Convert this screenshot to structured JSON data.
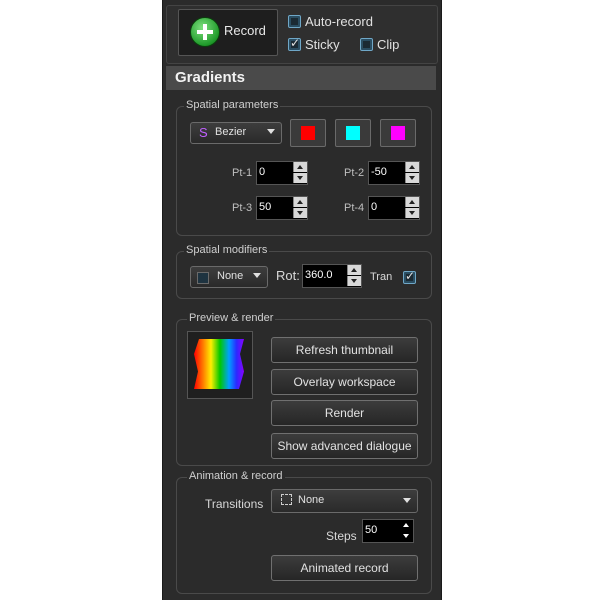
{
  "toolbar": {
    "record_label": "Record",
    "auto_record_label": "Auto-record",
    "sticky_label": "Sticky",
    "clip_label": "Clip",
    "auto_record_checked": false,
    "sticky_checked": true,
    "clip_checked": false
  },
  "header": {
    "title": "Gradients"
  },
  "spatial_parameters": {
    "title": "Spatial parameters",
    "type_label": "Bezier",
    "colors": [
      "#ff0000",
      "#00ffff",
      "#ff00ff"
    ],
    "pt1_label": "Pt-1",
    "pt1_value": "0",
    "pt2_label": "Pt-2",
    "pt2_value": "-50",
    "pt3_label": "Pt-3",
    "pt3_value": "50",
    "pt4_label": "Pt-4",
    "pt4_value": "0"
  },
  "spatial_modifiers": {
    "title": "Spatial modifiers",
    "modifier_label": "None",
    "rot_label": "Rot:",
    "rot_value": "360.0",
    "tran_label": "Tran",
    "tran_checked": true
  },
  "preview": {
    "title": "Preview & render",
    "refresh_label": "Refresh thumbnail",
    "overlay_label": "Overlay workspace",
    "render_label": "Render",
    "advanced_label": "Show advanced dialogue"
  },
  "animation": {
    "title": "Animation & record",
    "transitions_label": "Transitions",
    "transitions_value": "None",
    "steps_label": "Steps",
    "steps_value": "50",
    "animated_record_label": "Animated record"
  },
  "icons": [
    "plus-circle-icon",
    "bezier-icon",
    "dotted-square-icon",
    "checkbox-icon"
  ]
}
